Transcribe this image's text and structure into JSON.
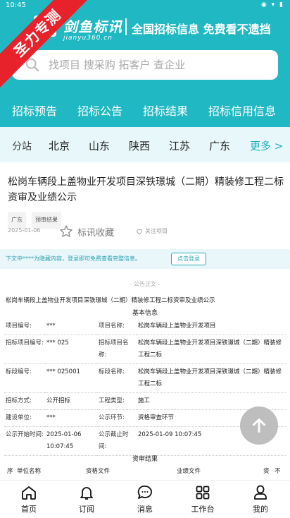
{
  "status_bar": {
    "time": "10:45"
  },
  "promo_ribbon": "圣力专测",
  "brand": {
    "name": "剑鱼标讯",
    "domain": "jianyu360.cn",
    "slogan": "全国招标信息 免费看不遗挡"
  },
  "search": {
    "placeholder": "找项目 搜采购 拓客户 查企业"
  },
  "categories": [
    "招标预告",
    "招标公告",
    "招标结果",
    "招标信用信息"
  ],
  "regions": {
    "label": "分站",
    "items": [
      "北京",
      "山东",
      "陕西",
      "江苏",
      "广东"
    ],
    "more": "更多 >"
  },
  "article": {
    "title": "松岗车辆段上盖物业开发项目深铁璟城（二期）精装修工程二标资审及业绩公示",
    "tags": [
      "广东",
      "预审结果"
    ],
    "date": "2025-01-06",
    "collect": "标讯收藏",
    "follow": "关注项目"
  },
  "notice": {
    "text": "下文中****为隐藏内容，登录即可免费查看完整信息。",
    "button": "点击登录"
  },
  "body": {
    "section_label": "- 公告正文 -",
    "doc_title": "松岗车辆段上盖物业开发项目深铁璟城（二期）精装修工程二标资审及业绩公示",
    "basic_info": "基本信息",
    "rows": [
      {
        "k1": "项目编号:",
        "v1": "***",
        "k2": "项目名称:",
        "v2": "松岗车辆段上盖物业开发项目"
      },
      {
        "k1": "招标项目编号:",
        "v1": "*** 025",
        "k2": "招标项目名称:",
        "v2": "松岗车辆段上盖物业开发项目深铁璟城（二期）精装修工程二标"
      },
      {
        "k1": "标段编号:",
        "v1": "*** 025001",
        "k2": "标段名称:",
        "v2": "松岗车辆段上盖物业开发项目深铁璟城（二期）精装修工程二标"
      },
      {
        "k1": "招标方式:",
        "v1": "公开招标",
        "k2": "工程类型:",
        "v2": "施工"
      },
      {
        "k1": "建设单位:",
        "v1": "***",
        "k2": "公示环节:",
        "v2": "资格审查环节"
      },
      {
        "k1": "公示开始时间:",
        "v1": "2025-01-06 10:07:45",
        "k2": "公示截止时间:",
        "v2": "2025-01-09 10:07:45"
      }
    ],
    "result_title": "资审结果",
    "result_headers": [
      "序",
      "单位名称",
      "资格文件",
      "业绩文件",
      "资",
      "不"
    ]
  },
  "nav": [
    "首页",
    "订阅",
    "消息",
    "工作台",
    "我的"
  ]
}
